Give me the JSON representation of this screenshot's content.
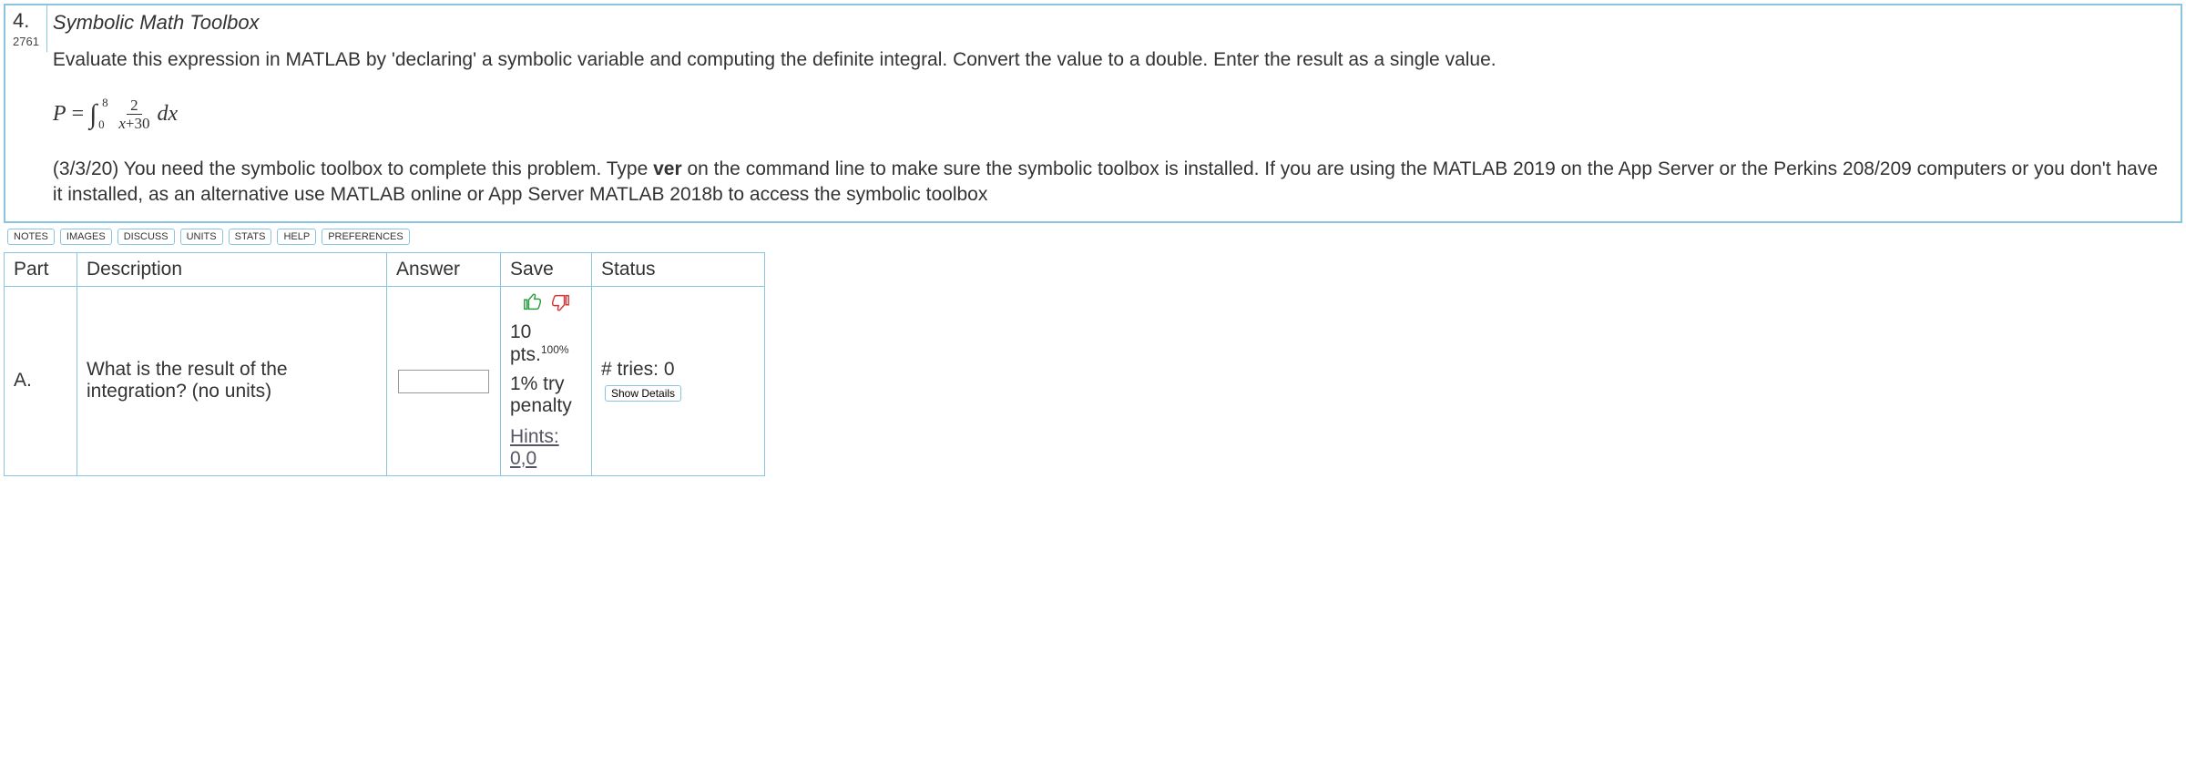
{
  "question": {
    "number": "4.",
    "id": "2761",
    "title": "Symbolic Math Toolbox",
    "prompt": "Evaluate this expression in MATLAB by 'declaring' a symbolic variable and computing the definite integral. Convert the value to a double. Enter the result as a single value.",
    "equation": {
      "lhs": "P",
      "int_lower": "0",
      "int_upper": "8",
      "frac_num": "2",
      "frac_den_left": "x",
      "frac_den_plus": "+30",
      "dx": "dx"
    },
    "note_prefix": "(3/3/20) You need the symbolic toolbox to complete this problem. Type ",
    "note_bold": "ver",
    "note_suffix": " on the command line to make sure the symbolic toolbox is installed. If you are using the MATLAB 2019 on the App Server or the Perkins 208/209 computers or you don't have it installed, as an alternative use MATLAB online or App Server MATLAB 2018b to access the symbolic toolbox"
  },
  "toolbar": {
    "notes": "NOTES",
    "images": "IMAGES",
    "discuss": "DISCUSS",
    "units": "UNITS",
    "stats": "STATS",
    "help": "HELP",
    "preferences": "PREFERENCES"
  },
  "table": {
    "headers": {
      "part": "Part",
      "description": "Description",
      "answer": "Answer",
      "save": "Save",
      "status": "Status"
    },
    "row": {
      "part": "A.",
      "description": "What is the result of the integration? (no units)",
      "answer_value": "",
      "save": {
        "points_label": "10 pts.",
        "percent": "100%",
        "penalty": "1% try penalty",
        "hints": "Hints: 0,0"
      },
      "status": {
        "tries_label": "# tries: 0",
        "show_details": "Show Details"
      }
    }
  }
}
